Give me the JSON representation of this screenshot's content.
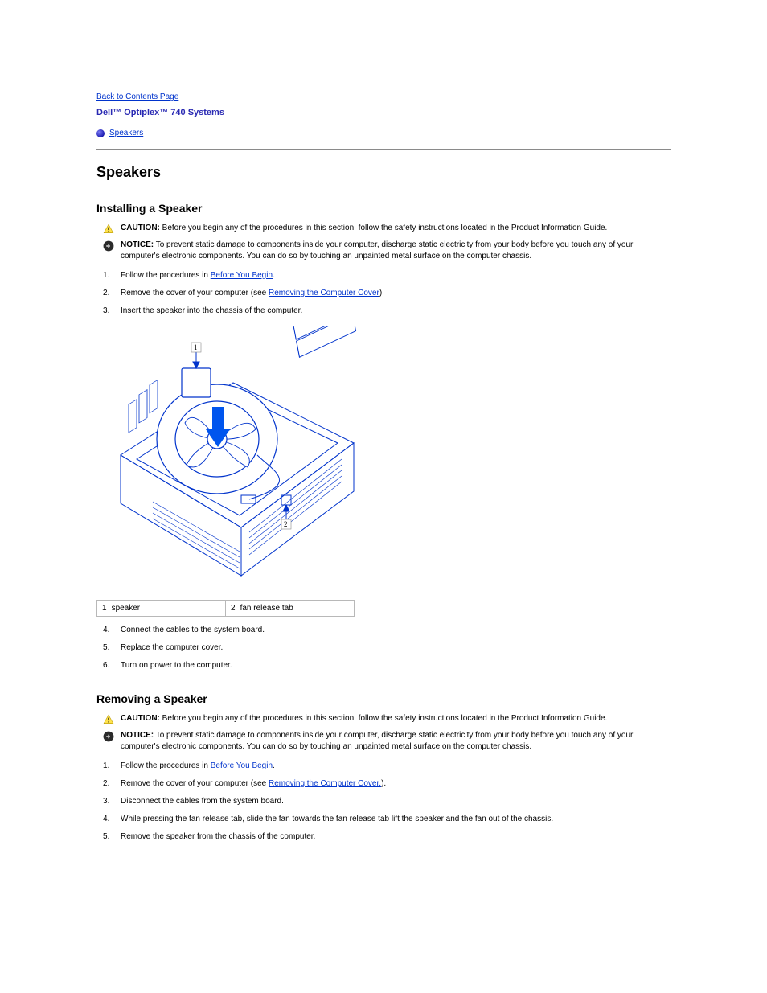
{
  "backlink": "Back to Contents Page",
  "doc_title": "Dell™ Optiplex™ 740 Systems",
  "toc": {
    "speakers": "Speakers"
  },
  "section": {
    "title": "Speakers"
  },
  "install": {
    "title": "Installing a Speaker",
    "caution_label": "CAUTION:",
    "caution_text": "Before you begin any of the procedures in this section, follow the safety instructions located in the Product Information Guide.",
    "notice_label": "NOTICE:",
    "notice_text": "To prevent static damage to components inside your computer, discharge static electricity from your body before you touch any of your computer's electronic components. You can do so by touching an unpainted metal surface on the computer chassis.",
    "step1_prefix": "Follow the procedures in ",
    "step1_link": "Before You Begin",
    "step1_suffix": ".",
    "step2_prefix": "Remove the cover of your computer (see ",
    "step2_link": "Removing the Computer Cover",
    "step2_suffix": ").",
    "step3": "Insert the speaker into the chassis of the computer.",
    "fig_labels": {
      "a_num": "1",
      "a_text": "speaker",
      "b_num": "2",
      "b_text": "fan release tab"
    },
    "step4": "Connect the cables to the system board.",
    "step5": "Replace the computer cover.",
    "step6": "Turn on power to the computer."
  },
  "remove": {
    "title": "Removing a Speaker",
    "caution_label": "CAUTION:",
    "caution_text": "Before you begin any of the procedures in this section, follow the safety instructions located in the Product Information Guide.",
    "notice_label": "NOTICE:",
    "notice_text": "To prevent static damage to components inside your computer, discharge static electricity from your body before you touch any of your computer's electronic components. You can do so by touching an unpainted metal surface on the computer chassis.",
    "step1_prefix": "Follow the procedures in ",
    "step1_link": "Before You Begin",
    "step1_suffix": ".",
    "step2_prefix": "Remove the cover of your computer (see ",
    "step2_link": "Removing the Computer Cover.",
    "step2_suffix": ").",
    "step3": "Disconnect the cables from the system board.",
    "step4": "While pressing the fan release tab, slide the fan towards the fan release tab lift the speaker and the fan out of the chassis.",
    "step5": "Remove the speaker from the chassis of the computer."
  }
}
